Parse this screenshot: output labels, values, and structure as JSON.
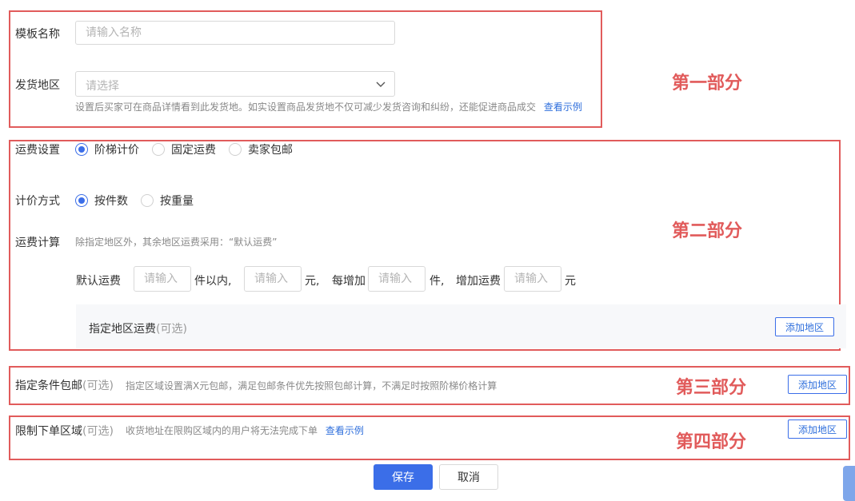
{
  "section1": {
    "template_name_label": "模板名称",
    "template_name_placeholder": "请输入名称",
    "ship_region_label": "发货地区",
    "ship_region_placeholder": "请选择",
    "ship_region_hint": "设置后买家可在商品详情看到此发货地。如实设置商品发货地不仅可减少发货咨询和纠纷，还能促进商品成交",
    "view_example": "查看示例",
    "annotation": "第一部分"
  },
  "section2": {
    "freight_setting_label": "运费设置",
    "freight_options": [
      "阶梯计价",
      "固定运费",
      "卖家包邮"
    ],
    "freight_selected": 0,
    "pricing_method_label": "计价方式",
    "pricing_options": [
      "按件数",
      "按重量"
    ],
    "pricing_selected": 0,
    "freight_calc_label": "运费计算",
    "freight_calc_hint": "除指定地区外，其余地区运费采用：“默认运费”",
    "default_freight_label": "默认运费",
    "input_placeholder": "请输入",
    "within_pieces": "件以内,",
    "yuan_comma": "元,",
    "each_add": "每增加",
    "piece_comma": "件,",
    "add_freight": "增加运费",
    "yuan": "元",
    "specified_region_label": "指定地区运费",
    "optional": "(可选)",
    "add_region_button": "添加地区",
    "annotation": "第二部分"
  },
  "section3": {
    "label": "指定条件包邮",
    "optional": "(可选)",
    "hint": "指定区域设置满X元包邮，满足包邮条件优先按照包邮计算，不满足时按照阶梯价格计算",
    "add_region_button": "添加地区",
    "annotation": "第三部分"
  },
  "section4": {
    "label": "限制下单区域",
    "optional": "(可选)",
    "hint": "收货地址在限购区域内的用户将无法完成下单",
    "view_example": "查看示例",
    "add_region_button": "添加地区",
    "annotation": "第四部分"
  },
  "footer": {
    "save_button": "保存",
    "cancel_button": "取消"
  },
  "colors": {
    "accent": "#3b6ee8",
    "annotation_red": "#e15b5b"
  }
}
